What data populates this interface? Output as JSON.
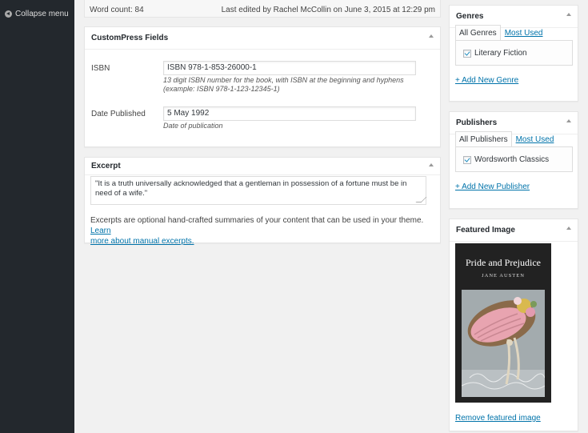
{
  "sidebar": {
    "collapse_label": "Collapse menu"
  },
  "status": {
    "word_count": "Word count: 84",
    "last_edited": "Last edited by Rachel McCollin on June 3, 2015 at 12:29 pm"
  },
  "custompress": {
    "title": "CustomPress Fields",
    "isbn_label": "ISBN",
    "isbn_value": "ISBN 978-1-853-26000-1",
    "isbn_desc_1": "13 digit ISBN number for the book, with ISBN at the beginning and hyphens",
    "isbn_desc_2": "(example: ISBN 978-1-123-12345-1)",
    "date_label": "Date Published",
    "date_value": "5 May 1992",
    "date_desc": "Date of publication"
  },
  "excerpt": {
    "title": "Excerpt",
    "text_1": "\"It is a truth universally acknowledged that a gentleman in possession of a fortune must be in",
    "text_2": "need of a wife.\"",
    "help_1": "Excerpts are optional hand-crafted summaries of your content that can be used in your theme.",
    "help_link_1": "Learn",
    "help_link_2": "more about manual excerpts."
  },
  "genres": {
    "title": "Genres",
    "tab_all": "All Genres",
    "tab_most": "Most Used",
    "item": "Literary Fiction",
    "add_link": "+ Add New Genre"
  },
  "publishers": {
    "title": "Publishers",
    "tab_all": "All Publishers",
    "tab_most": "Most Used",
    "item": "Wordsworth Classics",
    "add_link": "+ Add New Publisher"
  },
  "featured": {
    "title": "Featured Image",
    "book_title": "Pride and Prejudice",
    "book_author": "JANE AUSTEN",
    "remove_link": "Remove featured image"
  },
  "colors": {
    "sidebar_bg": "#23282d",
    "link": "#0073aa",
    "page_bg": "#f1f1f1"
  }
}
